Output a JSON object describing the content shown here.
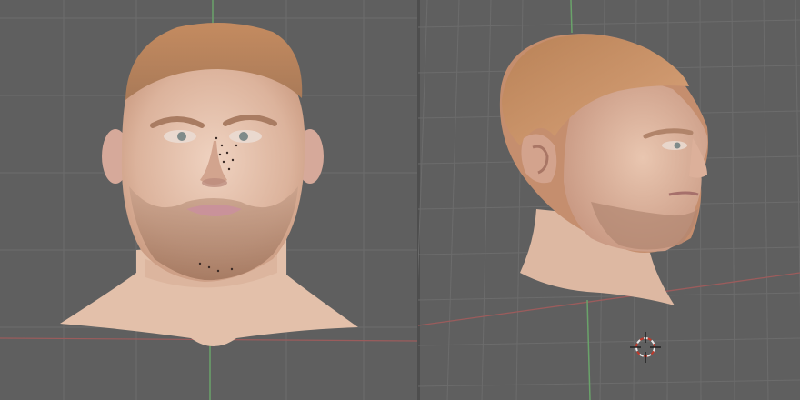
{
  "app": {
    "title": ""
  },
  "viewports": [
    {
      "id": "front",
      "view": "front-orthographic"
    },
    {
      "id": "side",
      "view": "right-perspective"
    }
  ],
  "colors": {
    "background": "#5f5f5f",
    "grid_line": "#6c6c6c",
    "x_axis": "#9b5c5c",
    "y_axis": "#6aa36a",
    "skin": "#e4c0aa",
    "skin_shadow": "#c99983",
    "hair": "#b97e56",
    "beard": "#9a6a4e",
    "lips": "#c9929a",
    "iris": "#7f8b8a"
  },
  "icons": {
    "cursor": "3d-cursor-icon"
  }
}
